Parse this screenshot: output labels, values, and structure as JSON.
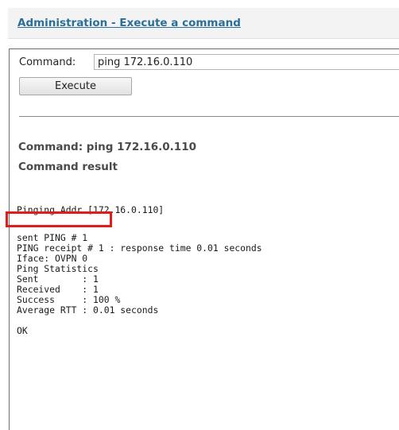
{
  "header": {
    "title": "Administration - Execute a command"
  },
  "form": {
    "command_label": "Command:",
    "command_value": "ping 172.16.0.110",
    "execute_label": "Execute"
  },
  "result": {
    "command_line": "Command: ping 172.16.0.110",
    "heading": "Command result",
    "lines": [
      "Pinging Addr [172.16.0.110]",
      "sent PING # 1",
      "PING receipt # 1 : response time 0.01 seconds",
      "Iface: OVPN 0",
      "Ping Statistics",
      "Sent        : 1",
      "Received    : 1",
      "Success     : 100 %",
      "Average RTT : 0.01 seconds",
      "OK"
    ]
  },
  "annotation": {
    "highlight_color": "#e21b1b",
    "highlighted_line": "Iface: OVPN 0"
  },
  "colors": {
    "title_link": "#2a6f98",
    "header_bg": "#f3f3f3"
  }
}
